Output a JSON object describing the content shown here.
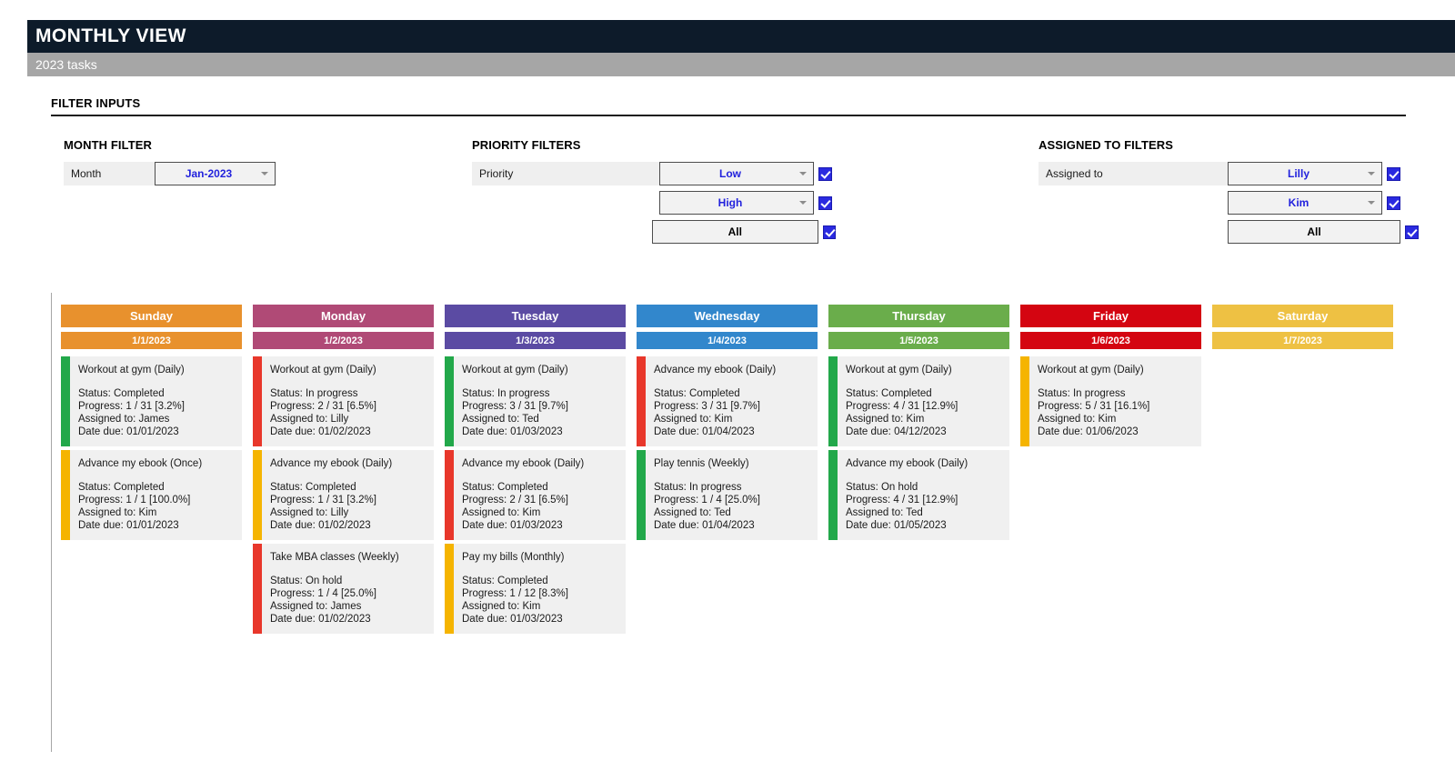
{
  "header": {
    "title": "MONTHLY VIEW",
    "subtitle": "2023 tasks"
  },
  "filters": {
    "section_title": "FILTER INPUTS",
    "month": {
      "group_title": "MONTH FILTER",
      "label": "Month",
      "value": "Jan-2023",
      "arrow_icon": "chevron-down-icon"
    },
    "priority": {
      "group_title": "PRIORITY FILTERS",
      "label": "Priority",
      "rows": [
        {
          "value": "Low",
          "checked": true,
          "plain": false
        },
        {
          "value": "High",
          "checked": true,
          "plain": false
        },
        {
          "value": "All",
          "checked": true,
          "plain": true
        }
      ]
    },
    "assigned": {
      "group_title": "ASSIGNED TO FILTERS",
      "label": "Assigned to",
      "rows": [
        {
          "value": "Lilly",
          "checked": true,
          "plain": false
        },
        {
          "value": "Kim",
          "checked": true,
          "plain": false
        },
        {
          "value": "All",
          "checked": true,
          "plain": true
        }
      ]
    }
  },
  "colors": {
    "banner": "#0d1b2a",
    "subbanner": "#a6a6a6",
    "dropdown_text": "#2222dd",
    "checkbox": "#2a2ae0",
    "sunday": "#e8912d",
    "monday": "#b04a76",
    "tuesday": "#5b4ba3",
    "wednesday": "#3287cc",
    "thursday": "#6aad4b",
    "friday": "#d40511",
    "saturday": "#eec143",
    "accent_green": "#22a84a",
    "accent_yellow": "#f5b400",
    "accent_red": "#e8372b",
    "card_bg": "#f0f0f0"
  },
  "calendar": {
    "days": [
      {
        "name": "Sunday",
        "date": "1/1/2023",
        "color": "#e8912d",
        "tasks": [
          {
            "title": "Workout at gym (Daily)",
            "status": "Status: Completed",
            "progress": "Progress: 1 / 31  [3.2%]",
            "assigned": "Assigned to: James",
            "due": "Date due: 01/01/2023",
            "accent": "#22a84a"
          },
          {
            "title": "Advance my ebook (Once)",
            "status": "Status: Completed",
            "progress": "Progress: 1 / 1  [100.0%]",
            "assigned": "Assigned to: Kim",
            "due": "Date due: 01/01/2023",
            "accent": "#f5b400"
          }
        ]
      },
      {
        "name": "Monday",
        "date": "1/2/2023",
        "color": "#b04a76",
        "tasks": [
          {
            "title": "Workout at gym (Daily)",
            "status": "Status: In progress",
            "progress": "Progress: 2 / 31  [6.5%]",
            "assigned": "Assigned to: Lilly",
            "due": "Date due: 01/02/2023",
            "accent": "#e8372b"
          },
          {
            "title": "Advance my ebook (Daily)",
            "status": "Status: Completed",
            "progress": "Progress: 1 / 31  [3.2%]",
            "assigned": "Assigned to: Lilly",
            "due": "Date due: 01/02/2023",
            "accent": "#f5b400"
          },
          {
            "title": "Take MBA classes (Weekly)",
            "status": "Status: On hold",
            "progress": "Progress: 1 / 4  [25.0%]",
            "assigned": "Assigned to: James",
            "due": "Date due: 01/02/2023",
            "accent": "#e8372b"
          }
        ]
      },
      {
        "name": "Tuesday",
        "date": "1/3/2023",
        "color": "#5b4ba3",
        "tasks": [
          {
            "title": "Workout at gym (Daily)",
            "status": "Status: In progress",
            "progress": "Progress: 3 / 31  [9.7%]",
            "assigned": "Assigned to: Ted",
            "due": "Date due: 01/03/2023",
            "accent": "#22a84a"
          },
          {
            "title": "Advance my ebook (Daily)",
            "status": "Status: Completed",
            "progress": "Progress: 2 / 31  [6.5%]",
            "assigned": "Assigned to: Kim",
            "due": "Date due: 01/03/2023",
            "accent": "#e8372b"
          },
          {
            "title": "Pay my bills (Monthly)",
            "status": "Status: Completed",
            "progress": "Progress: 1 / 12  [8.3%]",
            "assigned": "Assigned to: Kim",
            "due": "Date due: 01/03/2023",
            "accent": "#f5b400"
          }
        ]
      },
      {
        "name": "Wednesday",
        "date": "1/4/2023",
        "color": "#3287cc",
        "tasks": [
          {
            "title": "Advance my ebook (Daily)",
            "status": "Status: Completed",
            "progress": "Progress: 3 / 31  [9.7%]",
            "assigned": "Assigned to: Kim",
            "due": "Date due: 01/04/2023",
            "accent": "#e8372b"
          },
          {
            "title": "Play tennis (Weekly)",
            "status": "Status: In progress",
            "progress": "Progress: 1 / 4  [25.0%]",
            "assigned": "Assigned to: Ted",
            "due": "Date due: 01/04/2023",
            "accent": "#22a84a"
          }
        ]
      },
      {
        "name": "Thursday",
        "date": "1/5/2023",
        "color": "#6aad4b",
        "tasks": [
          {
            "title": "Workout at gym (Daily)",
            "status": "Status: Completed",
            "progress": "Progress: 4 / 31  [12.9%]",
            "assigned": "Assigned to: Kim",
            "due": "Date due: 04/12/2023",
            "accent": "#22a84a"
          },
          {
            "title": "Advance my ebook (Daily)",
            "status": "Status: On hold",
            "progress": "Progress: 4 / 31  [12.9%]",
            "assigned": "Assigned to: Ted",
            "due": "Date due: 01/05/2023",
            "accent": "#22a84a"
          }
        ]
      },
      {
        "name": "Friday",
        "date": "1/6/2023",
        "color": "#d40511",
        "tasks": [
          {
            "title": "Workout at gym (Daily)",
            "status": "Status: In progress",
            "progress": "Progress: 5 / 31  [16.1%]",
            "assigned": "Assigned to: Kim",
            "due": "Date due: 01/06/2023",
            "accent": "#f5b400"
          }
        ]
      },
      {
        "name": "Saturday",
        "date": "1/7/2023",
        "color": "#eec143",
        "tasks": []
      }
    ]
  }
}
